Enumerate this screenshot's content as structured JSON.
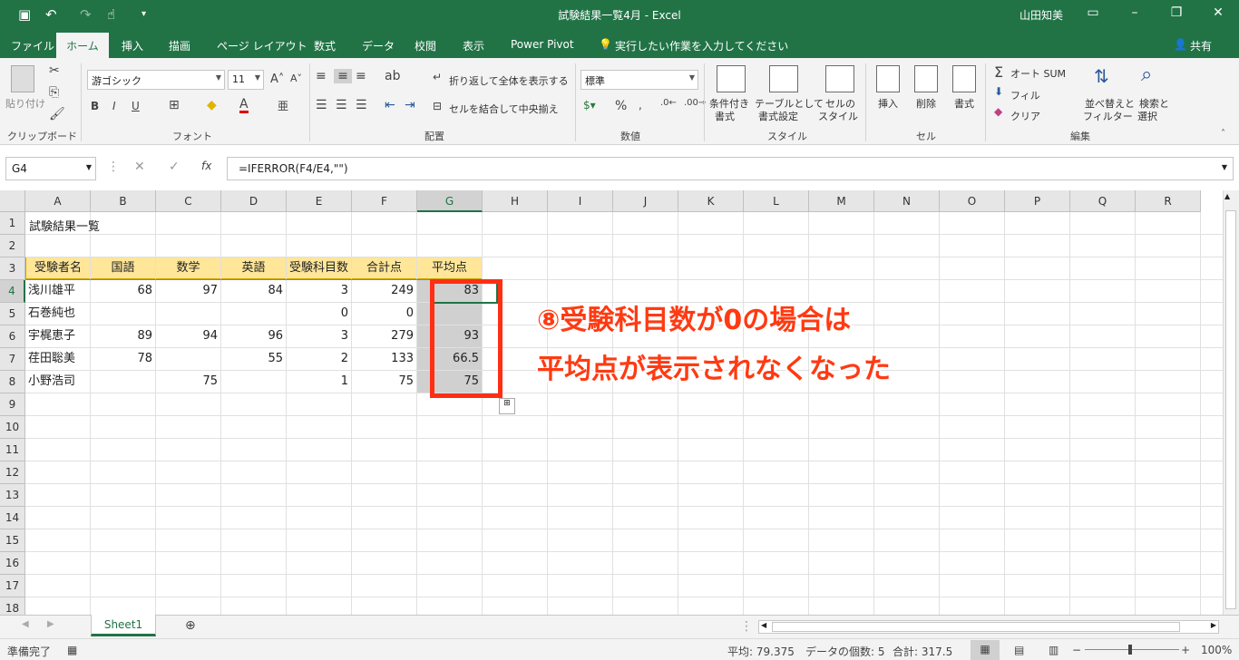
{
  "window": {
    "title": "試験結果一覧4月  -  Excel",
    "user": "山田知美",
    "share": "共有"
  },
  "tabs": [
    "ファイル",
    "ホーム",
    "挿入",
    "描画",
    "ページ レイアウト",
    "数式",
    "データ",
    "校閲",
    "表示",
    "Power Pivot"
  ],
  "tell_me": "実行したい作業を入力してください",
  "ribbon": {
    "paste": "貼り付け",
    "clipboard": "クリップボード",
    "font_name": "游ゴシック",
    "font_size": "11",
    "font_group": "フォント",
    "wrap_text": "折り返して全体を表示する",
    "merge": "セルを結合して中央揃え",
    "align_group": "配置",
    "number_format": "標準",
    "number_group": "数値",
    "cond_format": [
      "条件付き",
      "書式"
    ],
    "table_format": [
      "テーブルとして",
      "書式設定"
    ],
    "cell_style": [
      "セルの",
      "スタイル"
    ],
    "style_group": "スタイル",
    "insert": "挿入",
    "delete": "削除",
    "format": "書式",
    "cells_group": "セル",
    "autosum": "オート SUM",
    "fill": "フィル",
    "clear": "クリア",
    "sort": [
      "並べ替えと",
      "フィルター"
    ],
    "find": [
      "検索と",
      "選択"
    ],
    "edit_group": "編集"
  },
  "formula_bar": {
    "name_box": "G4",
    "formula": "=IFERROR(F4/E4,\"\")"
  },
  "columns": [
    "A",
    "B",
    "C",
    "D",
    "E",
    "F",
    "G",
    "H",
    "I",
    "J",
    "K",
    "L",
    "M",
    "N",
    "O",
    "P",
    "Q",
    "R"
  ],
  "rows": [
    "1",
    "2",
    "3",
    "4",
    "5",
    "6",
    "7",
    "8",
    "9",
    "10",
    "11",
    "12",
    "13",
    "14",
    "15",
    "16",
    "17",
    "18"
  ],
  "sheet": {
    "title": "試験結果一覧",
    "headers": [
      "受験者名",
      "国語",
      "数学",
      "英語",
      "受験科目数",
      "合計点",
      "平均点"
    ],
    "data": [
      [
        "浅川雄平",
        "68",
        "97",
        "84",
        "3",
        "249",
        "83"
      ],
      [
        "石巻純也",
        "",
        "",
        "",
        "0",
        "0",
        ""
      ],
      [
        "宇梶恵子",
        "89",
        "94",
        "96",
        "3",
        "279",
        "93"
      ],
      [
        "荏田聡美",
        "78",
        "",
        "55",
        "2",
        "133",
        "66.5"
      ],
      [
        "小野浩司",
        "",
        "75",
        "",
        "1",
        "75",
        "75"
      ]
    ]
  },
  "annotation": {
    "line1": "⑧受験科目数が0の場合は",
    "line2": "平均点が表示されなくなった",
    "color": "#ff3a12"
  },
  "sheet_tab": "Sheet1",
  "status": {
    "ready": "準備完了",
    "average": "平均: 79.375",
    "count": "データの個数: 5",
    "sum": "合計: 317.5",
    "zoom": "100%"
  },
  "colors": {
    "brand": "#217346",
    "header_fill": "#ffe699",
    "selected_fill": "#d0d0d0"
  }
}
